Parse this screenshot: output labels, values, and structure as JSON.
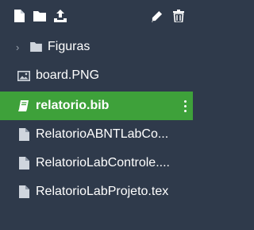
{
  "toolbar": {
    "icons": [
      "new-file-icon",
      "new-folder-icon",
      "upload-icon",
      "rename-pencil-icon",
      "delete-trash-icon"
    ]
  },
  "tree": {
    "folder": {
      "label": "Figuras",
      "expanded": false
    },
    "items": [
      {
        "label": "board.PNG",
        "icon": "image-icon"
      },
      {
        "label": "relatorio.bib",
        "icon": "book-icon",
        "selected": true
      },
      {
        "label": "RelatorioABNTLabCo...",
        "icon": "file-icon"
      },
      {
        "label": "RelatorioLabControle....",
        "icon": "file-icon"
      },
      {
        "label": "RelatorioLabProjeto.tex",
        "icon": "file-icon"
      }
    ]
  },
  "colors": {
    "background": "#2f3a4b",
    "selected": "#3ea13a",
    "icon": "#cfd5dd"
  }
}
